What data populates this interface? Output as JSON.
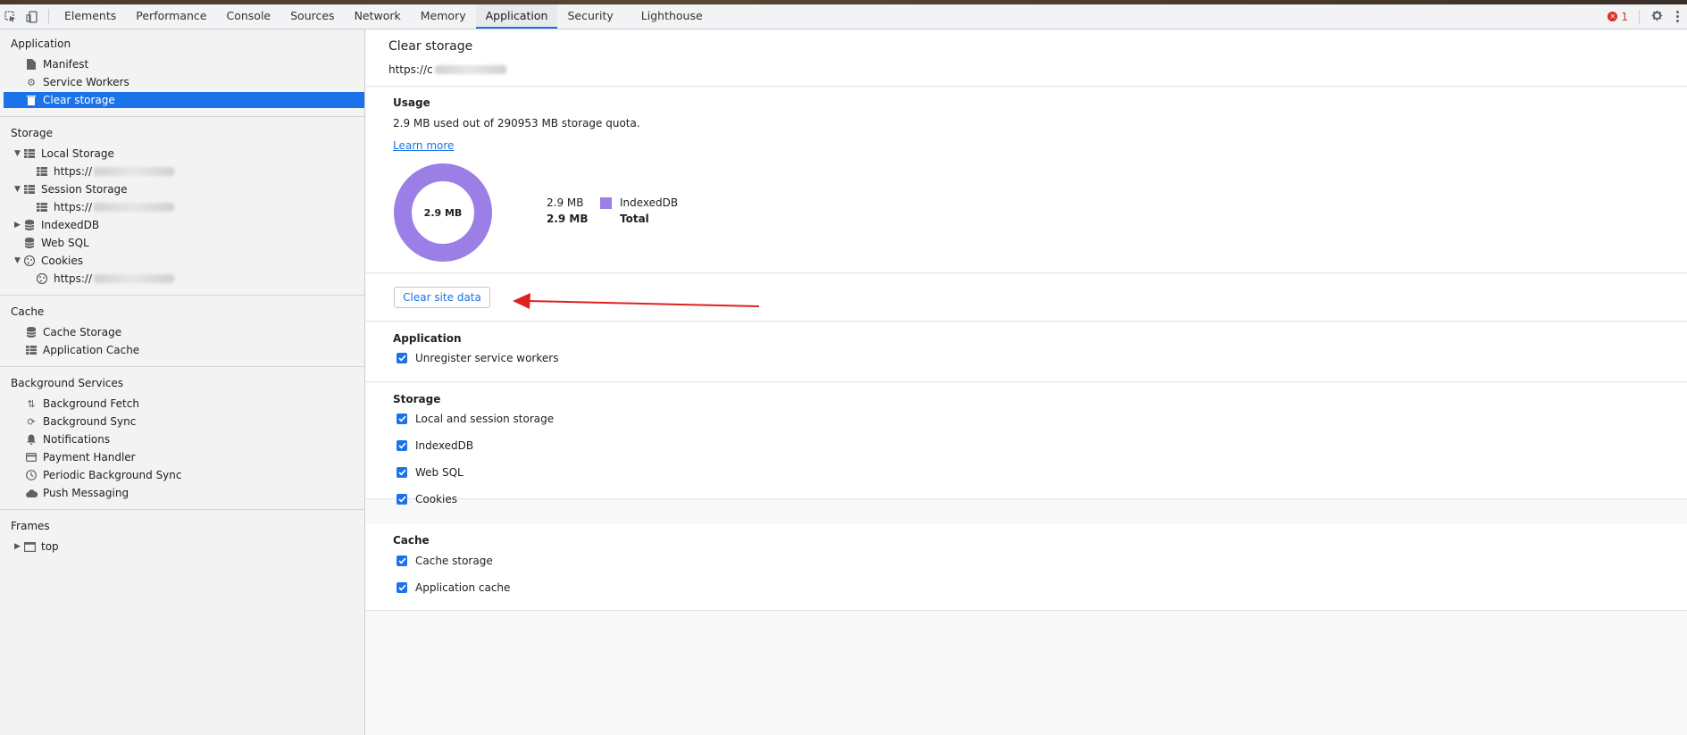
{
  "toolbar": {
    "tabs": [
      {
        "label": "Elements"
      },
      {
        "label": "Performance"
      },
      {
        "label": "Console"
      },
      {
        "label": "Sources"
      },
      {
        "label": "Network"
      },
      {
        "label": "Memory"
      },
      {
        "label": "Application"
      },
      {
        "label": "Security"
      },
      {
        "label": "Lighthouse"
      }
    ],
    "active_tab": "Application",
    "error_count": "1"
  },
  "sidebar": {
    "application": {
      "title": "Application",
      "items": [
        {
          "label": "Manifest",
          "icon": "file-icon"
        },
        {
          "label": "Service Workers",
          "icon": "gear-icon"
        },
        {
          "label": "Clear storage",
          "icon": "trash-icon",
          "selected": true
        }
      ]
    },
    "storage": {
      "title": "Storage",
      "local_storage": "Local Storage",
      "local_origin": "https://",
      "session_storage": "Session Storage",
      "session_origin": "https://",
      "indexeddb": "IndexedDB",
      "websql": "Web SQL",
      "cookies": "Cookies",
      "cookies_origin": "https://"
    },
    "cache": {
      "title": "Cache",
      "items": [
        {
          "label": "Cache Storage",
          "icon": "database-icon"
        },
        {
          "label": "Application Cache",
          "icon": "grid-icon"
        }
      ]
    },
    "background": {
      "title": "Background Services",
      "items": [
        {
          "label": "Background Fetch",
          "icon": "arrows-updown-icon"
        },
        {
          "label": "Background Sync",
          "icon": "sync-icon"
        },
        {
          "label": "Notifications",
          "icon": "bell-icon"
        },
        {
          "label": "Payment Handler",
          "icon": "card-icon"
        },
        {
          "label": "Periodic Background Sync",
          "icon": "clock-icon"
        },
        {
          "label": "Push Messaging",
          "icon": "cloud-icon"
        }
      ]
    },
    "frames": {
      "title": "Frames",
      "top": "top"
    }
  },
  "main": {
    "title": "Clear storage",
    "origin": "https://c",
    "usage": {
      "heading": "Usage",
      "text": "2.9 MB used out of 290953 MB storage quota.",
      "learn_more": "Learn more",
      "donut_label": "2.9 MB",
      "legend": [
        {
          "value": "2.9 MB",
          "label": "IndexedDB",
          "color": "#9b7fe6"
        },
        {
          "value": "2.9 MB",
          "label": "Total"
        }
      ]
    },
    "clear_button": "Clear site data",
    "application": {
      "heading": "Application",
      "options": [
        "Unregister service workers"
      ]
    },
    "storage": {
      "heading": "Storage",
      "options": [
        "Local and session storage",
        "IndexedDB",
        "Web SQL",
        "Cookies"
      ]
    },
    "cache": {
      "heading": "Cache",
      "options": [
        "Cache storage",
        "Application cache"
      ]
    }
  },
  "colors": {
    "accent": "#1a73e8",
    "indexeddb": "#9b7fe6",
    "annotation_arrow": "#e02020"
  }
}
